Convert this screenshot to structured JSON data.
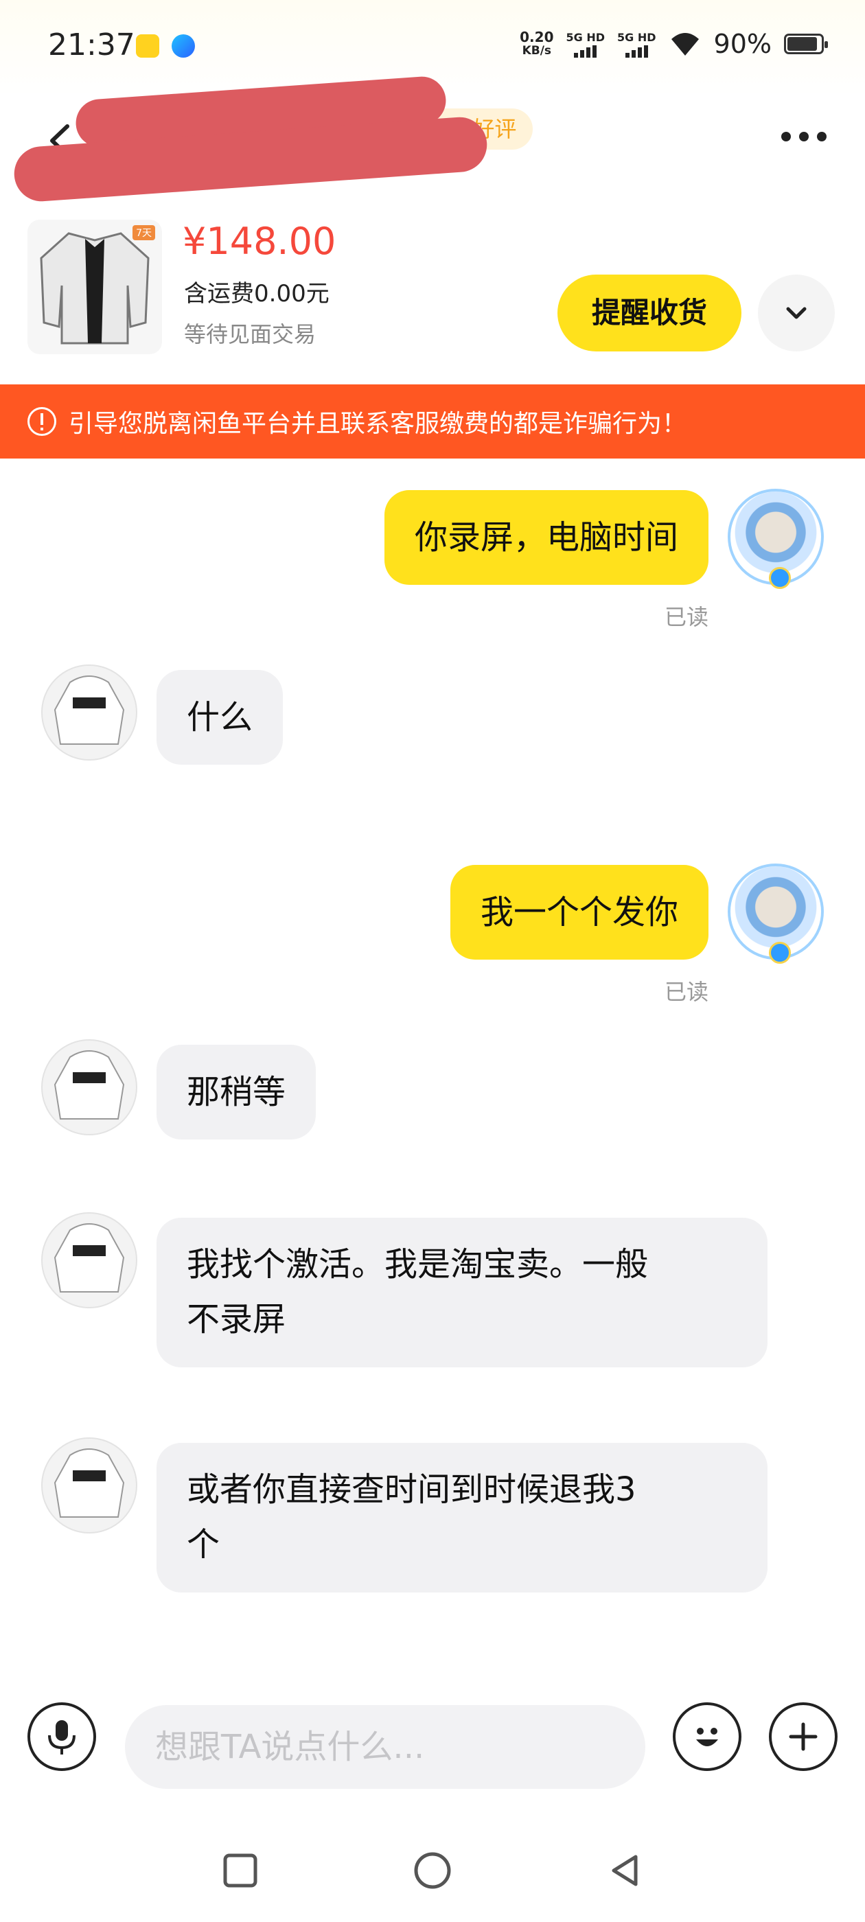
{
  "status_bar": {
    "time": "21:37",
    "net_speed_value": "0.20",
    "net_speed_unit": "KB/s",
    "sim1_label": "5G HD",
    "sim2_label": "5G HD",
    "battery_percent": "90%",
    "battery_level": 0.9
  },
  "header": {
    "peer_name": "闲",
    "peer_badge": "有1条好评"
  },
  "product": {
    "thumb_tag": "7天",
    "price": "¥148.00",
    "shipping": "含运费0.00元",
    "status": "等待见面交易",
    "remind_label": "提醒收货"
  },
  "warning": {
    "text": "引导您脱离闲鱼平台并且联系客服缴费的都是诈骗行为！"
  },
  "messages": [
    {
      "side": "out",
      "text": "你录屏，电脑时间",
      "status": "已读"
    },
    {
      "side": "in",
      "text": "什么"
    },
    {
      "side": "out",
      "text": "我一个个发你",
      "status": "已读"
    },
    {
      "side": "in",
      "text": "那稍等"
    },
    {
      "side": "in",
      "line1": "我找个激活。我是淘宝卖。一般",
      "line2": "不录屏"
    },
    {
      "side": "in",
      "line1": "或者你直接查时间到时候退我3",
      "line2": "个"
    }
  ],
  "input": {
    "placeholder": "想跟TA说点什么..."
  },
  "colors": {
    "accent_yellow": "#ffe11c",
    "price_red": "#f5483b",
    "warning_orange": "#ff5722",
    "incoming_bubble": "#f1f1f3"
  },
  "icons": {
    "back": "chevron-left-icon",
    "more": "more-dots-icon",
    "expand": "chevron-down-icon",
    "warning": "exclamation-circle-icon",
    "voice": "microphone-icon",
    "emoji": "emoji-icon",
    "plus": "plus-icon",
    "nav_recents": "square-icon",
    "nav_home": "circle-icon",
    "nav_back": "triangle-back-icon"
  }
}
